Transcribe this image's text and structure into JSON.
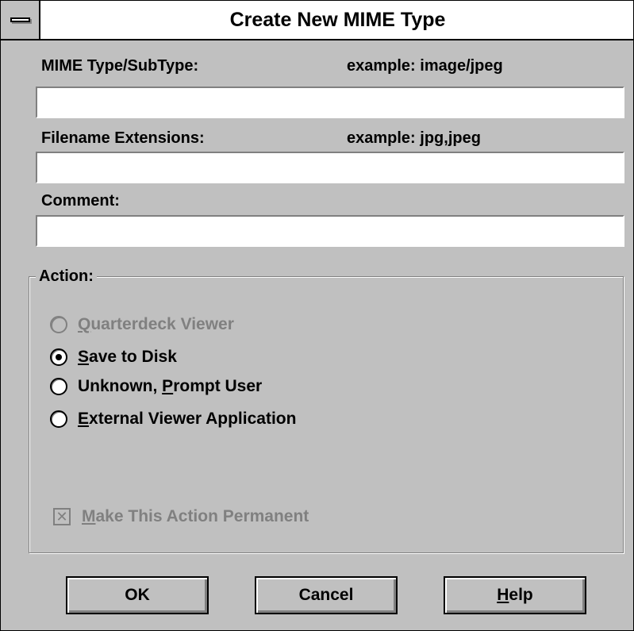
{
  "window": {
    "title": "Create New MIME Type",
    "sysmenu_icon": "system-menu-icon"
  },
  "fields": {
    "mime_label": "MIME Type/SubType:",
    "mime_example": "example: image/jpeg",
    "mime_value": "",
    "ext_label": "Filename Extensions:",
    "ext_example": "example: jpg,jpeg",
    "ext_value": "",
    "comment_label": "Comment:",
    "comment_value": ""
  },
  "action": {
    "group_label": "Action:",
    "options": [
      {
        "mnemonic": "Q",
        "rest": "uarterdeck Viewer",
        "enabled": false,
        "selected": false
      },
      {
        "mnemonic": "S",
        "rest": "ave to Disk",
        "enabled": true,
        "selected": true
      },
      {
        "prefix": "Unknown, ",
        "mnemonic": "P",
        "rest": "rompt User",
        "enabled": true,
        "selected": false
      },
      {
        "mnemonic": "E",
        "rest": "xternal Viewer Application",
        "enabled": true,
        "selected": false
      }
    ],
    "permanent": {
      "mnemonic": "M",
      "rest": "ake This Action Permanent",
      "checked": true,
      "enabled": false
    }
  },
  "buttons": {
    "ok": "OK",
    "cancel": "Cancel",
    "help_mnemonic": "H",
    "help_rest": "elp"
  },
  "colors": {
    "face": "#c0c0c0",
    "shadow": "#808080",
    "highlight": "#ffffff"
  }
}
